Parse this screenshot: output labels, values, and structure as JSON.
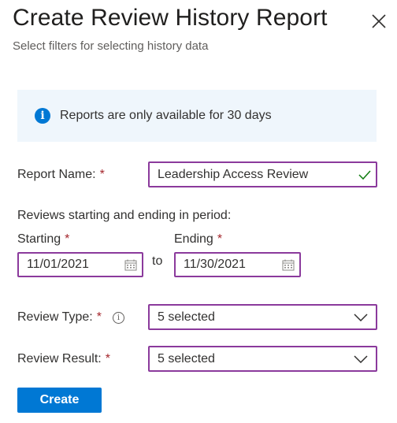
{
  "panel": {
    "title": "Create Review History Report",
    "subtitle": "Select filters for selecting history data"
  },
  "banner": {
    "text": "Reports are only available for 30 days"
  },
  "form": {
    "report_name_label": "Report Name:",
    "required_marker": "*",
    "report_name_value": "Leadership Access Review",
    "period_label": "Reviews starting and ending in period:",
    "starting_label": "Starting",
    "ending_label": "Ending",
    "to_label": "to",
    "start_date": "11/01/2021",
    "end_date": "11/30/2021",
    "review_type_label": "Review Type:",
    "review_type_value": "5 selected",
    "review_result_label": "Review Result:",
    "review_result_value": "5 selected"
  },
  "actions": {
    "create_label": "Create"
  },
  "colors": {
    "accent": "#0078d4",
    "focus_border": "#8b3a9c",
    "required": "#a4262c",
    "success_check": "#107c10",
    "banner_bg": "#eff6fc"
  },
  "icons": {
    "close": "close-icon",
    "info": "info-icon",
    "check": "check-icon",
    "calendar": "calendar-icon",
    "chevron": "chevron-down-icon"
  }
}
